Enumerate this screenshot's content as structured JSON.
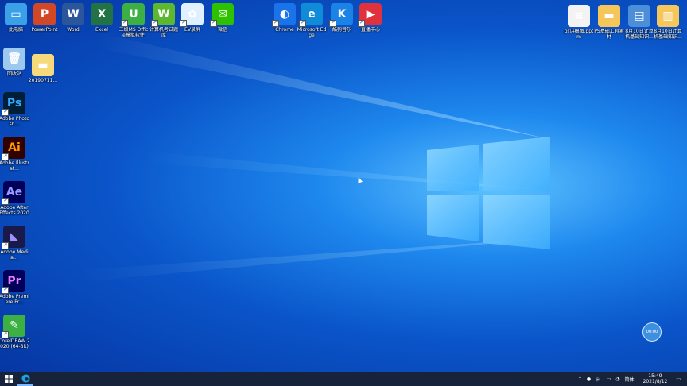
{
  "desktop": {
    "top_row": [
      {
        "label": "此电脑",
        "icon": "computer-icon",
        "color": "#3aa0e8",
        "glyph": "▭"
      },
      {
        "label": "PowerPoint",
        "icon": "powerpoint-icon",
        "color": "#d24726",
        "glyph": "P"
      },
      {
        "label": "Word",
        "icon": "word-icon",
        "color": "#2b579a",
        "glyph": "W"
      },
      {
        "label": "Excel",
        "icon": "excel-icon",
        "color": "#217346",
        "glyph": "X"
      },
      {
        "label": "二级MS Office模拟软件",
        "icon": "exam-software-icon",
        "color": "#3cb043",
        "glyph": "U"
      },
      {
        "label": "计算机考试题库",
        "icon": "exam-bank-icon",
        "color": "#5cb82e",
        "glyph": "W"
      },
      {
        "label": "EV录屏",
        "icon": "ev-recorder-icon",
        "color": "#e0f0ff",
        "glyph": "✿"
      },
      {
        "label": "微信",
        "icon": "wechat-icon",
        "color": "#2dc100",
        "glyph": "✉"
      },
      {
        "label": "Chrome",
        "icon": "browser-icon",
        "color": "#1a73e8",
        "glyph": "◐"
      },
      {
        "label": "Microsoft Edge",
        "icon": "edge-icon",
        "color": "#0f8bd9",
        "glyph": "e"
      },
      {
        "label": "酷狗音乐",
        "icon": "kugou-icon",
        "color": "#1b82e6",
        "glyph": "K"
      },
      {
        "label": "直播中心",
        "icon": "live-center-icon",
        "color": "#e0323c",
        "glyph": "▶"
      }
    ],
    "right_row": [
      {
        "label": "ps讲稿图.pptm",
        "icon": "pptm-file-icon",
        "color": "#f3f3f3",
        "glyph": "≡"
      },
      {
        "label": "PS基础工具素材",
        "icon": "folder-icon",
        "color": "#f5c75b",
        "glyph": "▬"
      },
      {
        "label": "8月10日计算机基础知识...",
        "icon": "rar-archive-icon",
        "color": "#4c8ed8",
        "glyph": "▤"
      },
      {
        "label": "8月10日计算机基础知识...",
        "icon": "document-archive-icon",
        "color": "#f5c75b",
        "glyph": "▥"
      }
    ],
    "left_column": [
      {
        "label": "回收站",
        "icon": "recycle-bin-icon",
        "color": "#9ec9ef",
        "glyph": "🗑"
      },
      {
        "label": "Adobe Photosh...",
        "icon": "photoshop-icon",
        "color": "#001e36",
        "glyph": "Ps",
        "fg": "#31a8ff"
      },
      {
        "label": "Adobe Illustrat...",
        "icon": "illustrator-icon",
        "color": "#330000",
        "glyph": "Ai",
        "fg": "#ff9a00"
      },
      {
        "label": "Adobe After Effects 2020",
        "icon": "after-effects-icon",
        "color": "#00005b",
        "glyph": "Ae",
        "fg": "#9999ff"
      },
      {
        "label": "Adobe Media...",
        "icon": "media-encoder-icon",
        "color": "#1a1a4a",
        "glyph": "◣",
        "fg": "#a08fff"
      },
      {
        "label": "Adobe Premiere Pr...",
        "icon": "premiere-icon",
        "color": "#00005b",
        "glyph": "Pr",
        "fg": "#e77cff"
      },
      {
        "label": "CorelDRAW 2020 (64-Bit)",
        "icon": "coreldraw-icon",
        "color": "#3cb043",
        "glyph": "✎"
      }
    ],
    "file_item": {
      "label": "20190711...",
      "icon": "folder-file-icon",
      "color": "#f5d97a",
      "glyph": "▬"
    }
  },
  "taskbar": {
    "start_icon": "windows-start-icon",
    "app_icon": "edge-taskbar-icon",
    "ime": "简体",
    "time": "15:49",
    "date": "2021/8/12"
  },
  "float_ball": {
    "text": "00:00"
  }
}
